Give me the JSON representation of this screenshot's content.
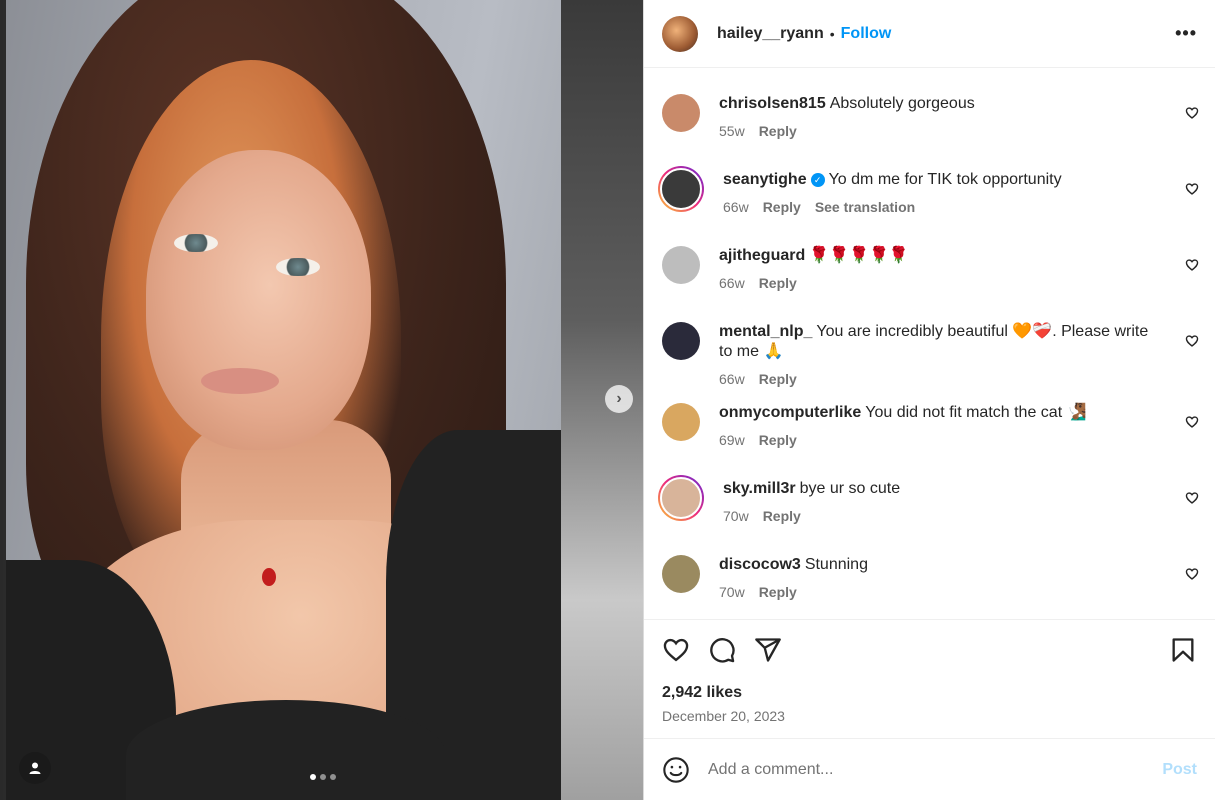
{
  "post": {
    "author": "hailey__ryann",
    "separator": "•",
    "follow_label": "Follow",
    "more_icon": "more-horizontal-icon",
    "more_label": "•••"
  },
  "carousel": {
    "next_label": "›",
    "current_slide": 1,
    "slide_count": 3
  },
  "comments": [
    {
      "user": "chrisolsen815",
      "text": "Absolutely gorgeous",
      "time": "55w",
      "reply": "Reply",
      "verified": false,
      "story_ring": false,
      "avatar_color": "#c98a6a"
    },
    {
      "user": "seanytighe",
      "text": "Yo dm me for TIK tok opportunity",
      "time": "66w",
      "reply": "Reply",
      "translate": "See translation",
      "verified": true,
      "story_ring": true,
      "avatar_color": "#3a3a3a"
    },
    {
      "user": "ajitheguard",
      "text": "🌹🌹🌹🌹🌹",
      "time": "66w",
      "reply": "Reply",
      "verified": false,
      "story_ring": false,
      "avatar_color": "#bdbdbd"
    },
    {
      "user": "mental_nlp_",
      "text": "You are incredibly beautiful 🧡❤️‍🩹. Please write to me 🙏",
      "time": "66w",
      "reply": "Reply",
      "verified": false,
      "story_ring": false,
      "avatar_color": "#2a2a3a"
    },
    {
      "user": "onmycomputerlike",
      "text": "You did not fit match the cat 🧏🏾‍♂️",
      "time": "69w",
      "reply": "Reply",
      "verified": false,
      "story_ring": false,
      "avatar_color": "#d9a760"
    },
    {
      "user": "sky.mill3r",
      "text": "bye ur so cute",
      "time": "70w",
      "reply": "Reply",
      "verified": false,
      "story_ring": true,
      "avatar_color": "#d8b49a"
    },
    {
      "user": "discocow3",
      "text": "Stunning",
      "time": "70w",
      "reply": "Reply",
      "verified": false,
      "story_ring": false,
      "avatar_color": "#9a8a60"
    }
  ],
  "actions": {
    "like_icon": "heart-icon",
    "comment_icon": "comment-icon",
    "share_icon": "send-icon",
    "save_icon": "bookmark-icon"
  },
  "stats": {
    "likes": "2,942 likes",
    "date": "December 20, 2023"
  },
  "compose": {
    "placeholder": "Add a comment...",
    "post_label": "Post",
    "emoji_icon": "emoji-icon"
  },
  "colors": {
    "link_blue": "#0095f6",
    "muted": "#737373",
    "post_disabled": "#b2dffc"
  }
}
